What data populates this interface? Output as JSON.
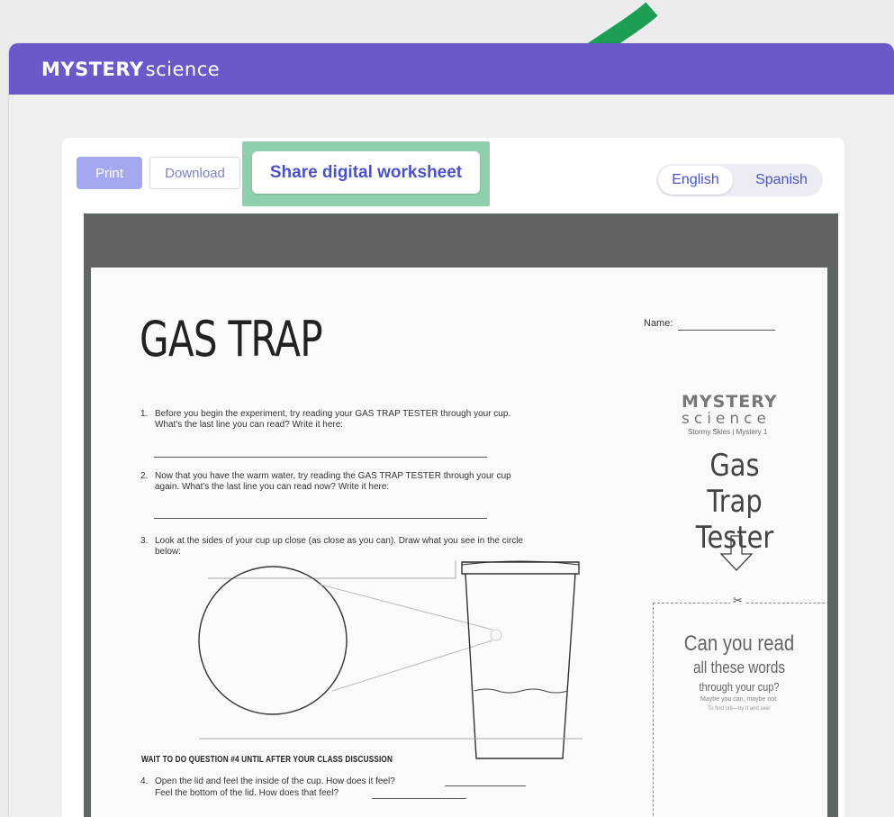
{
  "header": {
    "logo_strong": "MYSTERY",
    "logo_light": "science",
    "color": "#6a5ac9"
  },
  "toolbar": {
    "print_label": "Print",
    "download_label": "Download",
    "share_label": "Share digital worksheet"
  },
  "language": {
    "options": [
      "English",
      "Spanish"
    ],
    "selected": "English"
  },
  "worksheet": {
    "title": "GAS TRAP",
    "name_label": "Name:",
    "questions": [
      {
        "num": "1.",
        "text": "Before you begin the experiment, try reading your GAS TRAP TESTER through your cup. What's the last line you can read? Write it here:"
      },
      {
        "num": "2.",
        "text": "Now that you have the warm water, try reading the GAS TRAP TESTER through your cup again. What's the last line you can read now? Write it here:"
      },
      {
        "num": "3.",
        "text": "Look at the sides of your cup up close (as close as you can). Draw what you see in the circle below:"
      },
      {
        "num": "4.",
        "text": "Open the lid and feel the inside of the cup. How does it feel?"
      }
    ],
    "q4_followup": "Feel the bottom of the lid. How does that feel?",
    "wait_note": "WAIT TO DO QUESTION #4 UNTIL AFTER YOUR CLASS DISCUSSION",
    "side_logo_strong": "MYSTERY",
    "side_logo_light": "science",
    "side_subtitle": "Stormy Skies | Mystery 1",
    "side_title_line1": "Gas Trap",
    "side_title_line2": "Tester",
    "cut_icon": "scissors-icon",
    "tester_lines": [
      "Can you read",
      "all these words",
      "through your cup?",
      "Maybe you can, maybe not.",
      "To find out—try it and see!"
    ]
  },
  "annotation": {
    "arrow_color": "#1d9e55",
    "highlight_color": "#8ed0ac"
  }
}
